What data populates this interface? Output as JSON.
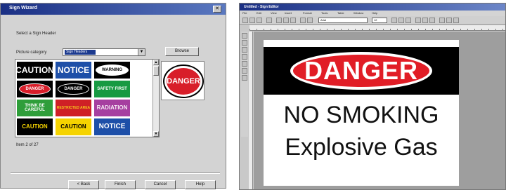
{
  "wizard": {
    "title": "Sign Wizard",
    "instruction": "Select a Sign Header",
    "category_label": "Picture category",
    "category_value": "Sign Headers",
    "browse_label": "Browse",
    "item_count": "Item 2 of 27",
    "tiles": [
      {
        "text": "CAUTION",
        "bg": "#000000",
        "fg": "#ffffff",
        "size": 12
      },
      {
        "text": "NOTICE",
        "bg": "#1d4fa8",
        "fg": "#ffffff",
        "size": 12
      },
      {
        "text": "WARNING",
        "bg": "#000000",
        "fg": "#000000",
        "size": 6,
        "pill": "#ffffff"
      },
      {
        "text": "DANGER",
        "bg": "#000000",
        "fg": "#ffffff",
        "size": 6,
        "pill": "#d81e2a"
      },
      {
        "text": "DANGER",
        "bg": "#000000",
        "fg": "#ffffff",
        "size": 6,
        "pill": "#000000"
      },
      {
        "text": "SAFETY FIRST",
        "bg": "#179a42",
        "fg": "#ffffff",
        "size": 6
      },
      {
        "text": "THINK BE CAREFUL",
        "bg": "#2f9e3a",
        "fg": "#ffffff",
        "size": 6
      },
      {
        "text": "RESTRICTED AREA",
        "bg": "#cf2026",
        "fg": "#f4c21d",
        "size": 5
      },
      {
        "text": "RADIATION",
        "bg": "#a63fa0",
        "fg": "#f4e6f3",
        "size": 8
      },
      {
        "text": "CAUTION",
        "bg": "#000000",
        "fg": "#f5d300",
        "size": 8
      },
      {
        "text": "CAUTION",
        "bg": "#f5d300",
        "fg": "#000000",
        "size": 8
      },
      {
        "text": "NOTICE",
        "bg": "#1d4fa8",
        "fg": "#ffffff",
        "size": 10
      }
    ],
    "preview_text": "DANGER",
    "buttons": {
      "back": "< Back",
      "finish": "Finish",
      "cancel": "Cancel",
      "help": "Help"
    },
    "close_glyph": "✕"
  },
  "editor": {
    "title": "Untitled - Sign Editor",
    "menus": [
      "File",
      "Edit",
      "View",
      "Insert",
      "Format",
      "Tools",
      "Table",
      "Window",
      "Help"
    ],
    "font_value": "Arial",
    "font_size": "12",
    "sign": {
      "header": "DANGER",
      "line1": "NO SMOKING",
      "line2": "Explosive Gas",
      "header_color": "#e11d26"
    }
  }
}
